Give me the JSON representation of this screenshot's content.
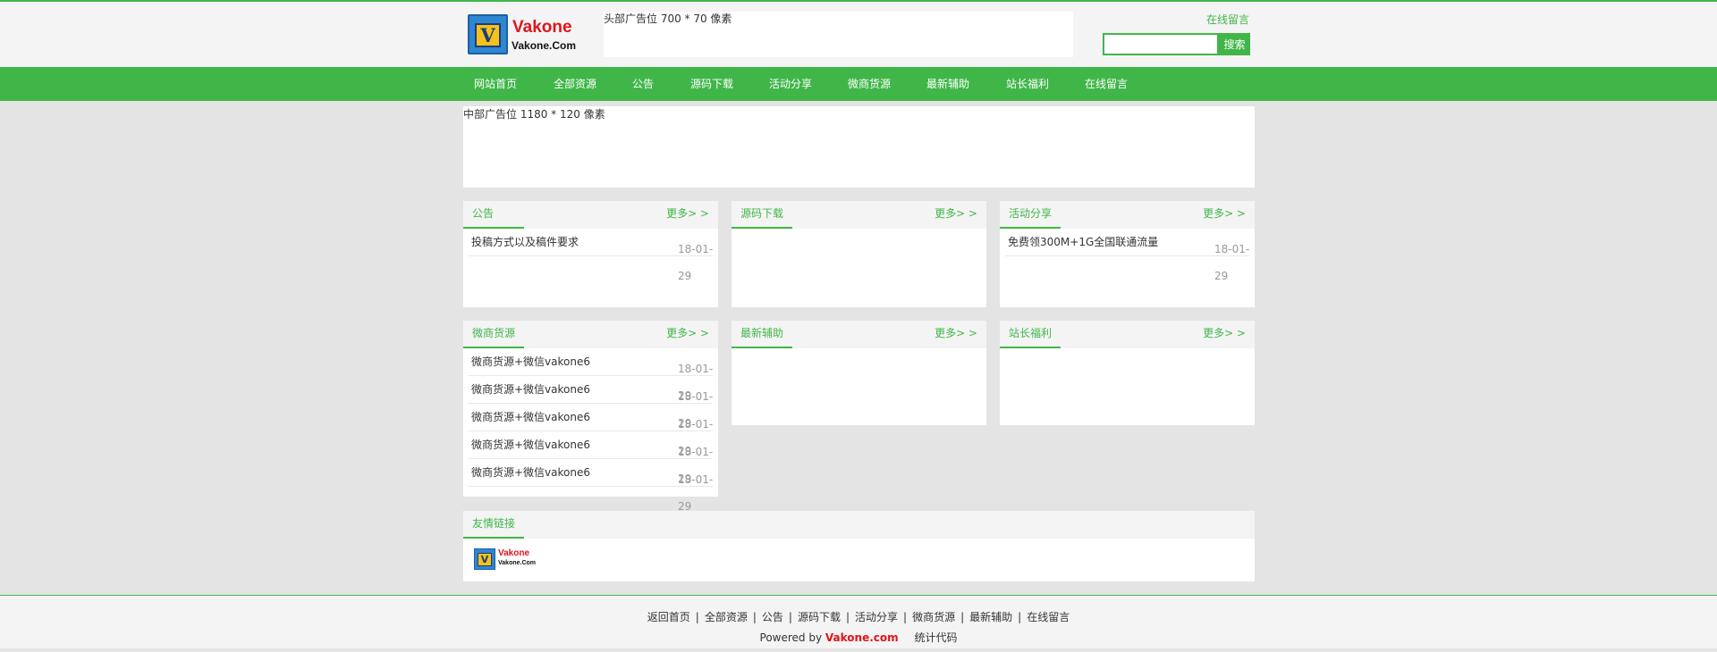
{
  "header": {
    "logo_name": "Vakone",
    "logo_sub": "Vakone.Com",
    "logo_glyph": "V",
    "ad_text": "头部广告位 700 * 70 像素",
    "online_message": "在线留言",
    "search_placeholder": "",
    "search_button": "搜索"
  },
  "nav": [
    "网站首页",
    "全部资源",
    "公告",
    "源码下载",
    "活动分享",
    "微商货源",
    "最新辅助",
    "站长福利",
    "在线留言"
  ],
  "middle_ad": "中部广告位 1180 * 120 像素",
  "more_label": "更多> >",
  "panels": {
    "notice": {
      "title": "公告",
      "rows": [
        {
          "title": "投稿方式以及稿件要求",
          "date": "18-01-29"
        }
      ]
    },
    "source": {
      "title": "源码下载",
      "rows": []
    },
    "activity": {
      "title": "活动分享",
      "rows": [
        {
          "title": "免费领300M+1G全国联通流量",
          "date": "18-01-29"
        }
      ]
    },
    "supply": {
      "title": "微商货源",
      "rows": [
        {
          "title": "微商货源+微信vakone6",
          "date": "18-01-29"
        },
        {
          "title": "微商货源+微信vakone6",
          "date": "18-01-29"
        },
        {
          "title": "微商货源+微信vakone6",
          "date": "18-01-29"
        },
        {
          "title": "微商货源+微信vakone6",
          "date": "18-01-29"
        },
        {
          "title": "微商货源+微信vakone6",
          "date": "18-01-29"
        }
      ]
    },
    "assist": {
      "title": "最新辅助",
      "rows": []
    },
    "welfare": {
      "title": "站长福利",
      "rows": []
    }
  },
  "friend_links": {
    "title": "友情链接",
    "logo_name": "Vakone",
    "logo_sub": "Vakone.Com",
    "logo_glyph": "V"
  },
  "footer": {
    "links": [
      "返回首页",
      "全部资源",
      "公告",
      "源码下载",
      "活动分享",
      "微商货源",
      "最新辅助",
      "在线留言"
    ],
    "separator": "|",
    "powered_by": "Powered by",
    "brand": "Vakone.com",
    "stat_code": "统计代码"
  },
  "colors": {
    "accent": "#40b649",
    "brand_red": "#e0141b",
    "logo_blue": "#2f86d1",
    "logo_yellow": "#f6c21a"
  }
}
